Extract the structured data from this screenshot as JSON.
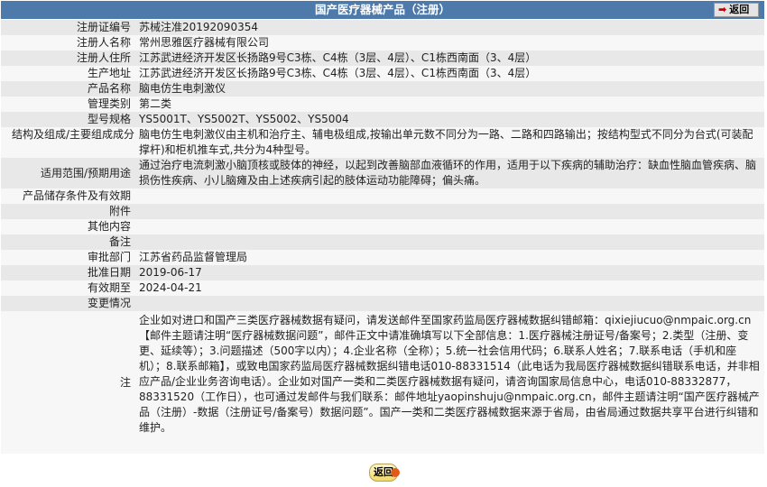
{
  "header": {
    "title": "国产医疗器械产品（注册）",
    "back_label": "返回"
  },
  "rows": [
    {
      "label": "注册证编号",
      "value": "苏械注准20192090354"
    },
    {
      "label": "注册人名称",
      "value": "常州思雅医疗器械有限公司"
    },
    {
      "label": "注册人住所",
      "value": "江苏武进经济开发区长扬路9号C3栋、C4栋（3层、4层）、C1栋西南面（3、4层）"
    },
    {
      "label": "生产地址",
      "value": "江苏武进经济开发区长扬路9号C3栋、C4栋（3层、4层）、C1栋西南面（3、4层）"
    },
    {
      "label": "产品名称",
      "value": "脑电仿生电刺激仪"
    },
    {
      "label": "管理类别",
      "value": "第二类"
    },
    {
      "label": "型号规格",
      "value": "YS5001T、YS5002T、YS5002、YS5004"
    },
    {
      "label": "结构及组成/主要组成成分",
      "value": "脑电仿生电刺激仪由主机和治疗主、辅电极组成,按输出单元数不同分为一路、二路和四路输出；按结构型式不同分为台式(可装配撑杆)和柜机推车式,共分为4种型号。"
    },
    {
      "label": "适用范围/预期用途",
      "value": "通过治疗电流刺激小脑顶核或肢体的神经，以起到改善脑部血液循环的作用，适用于以下疾病的辅助治疗：缺血性脑血管疾病、脑损伤性疾病、小儿脑瘫及由上述疾病引起的肢体运动功能障碍；偏头痛。"
    },
    {
      "label": "产品储存条件及有效期",
      "value": ""
    },
    {
      "label": "附件",
      "value": ""
    },
    {
      "label": "其他内容",
      "value": ""
    },
    {
      "label": "备注",
      "value": ""
    },
    {
      "label": "审批部门",
      "value": "江苏省药品监督管理局"
    },
    {
      "label": "批准日期",
      "value": "2019-06-17"
    },
    {
      "label": "有效期至",
      "value": "2024-04-21"
    },
    {
      "label": "变更情况",
      "value": ""
    },
    {
      "label": "注",
      "value": "企业如对进口和国产三类医疗器械数据有疑问，请发送邮件至国家药监局医疗器械数据纠错邮箱：qixiejiucuo@nmpaic.org.cn【邮件主题请注明“医疗器械数据问题”，邮件正文中请准确填写以下全部信息：1.医疗器械注册证号/备案号；2.类型（注册、变更、延续等）；3.问题描述（500字以内）；4.企业名称（全称）；5.统一社会信用代码；6.联系人姓名；7.联系电话（手机和座机）；8.联系邮箱】，或致电国家药监局医疗器械数据纠错电话010-88331514（此电话为我局医疗器械数据纠错联系电话，并非相应产品/企业业务咨询电话）。企业如对国产一类和二类医疗器械数据有疑问，请咨询国家局信息中心，电话010-88332877，88331520（工作日），也可通过发邮件与我们联系：邮件地址yaopinshuju@nmpaic.org.cn，邮件主题请注明“国产医疗器械产品（注册）-数据（注册证号/备案号）数据问题”。国产一类和二类医疗器械数据来源于省局，由省局通过数据共享平台进行纠错和维护。"
    }
  ],
  "footer": {
    "back_label": "返回"
  },
  "colors": {
    "header_bg": "#4d7aaa",
    "row_odd": "#e8e8e8",
    "row_even": "#f7f7f7"
  }
}
